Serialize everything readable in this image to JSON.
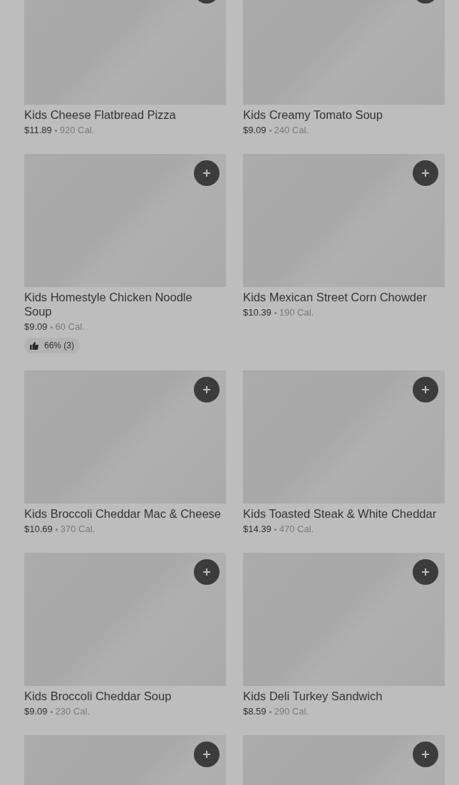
{
  "items": [
    {
      "kind": "product",
      "title": "Kids Cheese Flatbread Pizza",
      "price": "$11.89",
      "calories": "920 Cal."
    },
    {
      "kind": "product",
      "title": "Kids Creamy Tomato Soup",
      "price": "$9.09",
      "calories": "240 Cal."
    },
    {
      "kind": "product",
      "title": "Kids Homestyle Chicken Noodle Soup",
      "price": "$9.09",
      "calories": "60 Cal.",
      "rating": "66% (3)"
    },
    {
      "kind": "product",
      "title": "Kids Mexican Street Corn Chowder",
      "price": "$10.39",
      "calories": "190 Cal."
    },
    {
      "kind": "product",
      "title": "Kids Broccoli Cheddar Mac & Cheese",
      "price": "$10.69",
      "calories": "370 Cal."
    },
    {
      "kind": "product",
      "title": "Kids Toasted Steak & White Cheddar",
      "price": "$14.39",
      "calories": "470 Cal."
    },
    {
      "kind": "product",
      "title": "Kids Broccoli Cheddar Soup",
      "price": "$9.09",
      "calories": "230 Cal."
    },
    {
      "kind": "product",
      "title": "Kids Deli Turkey Sandwich",
      "price": "$8.59",
      "calories": "290 Cal."
    },
    {
      "kind": "picture"
    },
    {
      "kind": "picture"
    }
  ]
}
